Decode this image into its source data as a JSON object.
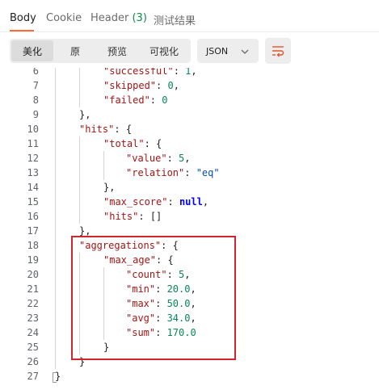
{
  "tabs": {
    "body": "Body",
    "cookie": "Cookie",
    "header": "Header",
    "header_count": "(3)",
    "test_results": "测试结果"
  },
  "toolbar": {
    "format_buttons": [
      "美化",
      "原",
      "预览",
      "可视化"
    ],
    "active_format": "美化",
    "language": "JSON",
    "wrap_icon": "text-wrap-icon"
  },
  "colors": {
    "accent": "#ff6c37",
    "key": "#a31515",
    "number": "#098658",
    "string": "#0451a5",
    "keyword": "#0000ff",
    "highlight": "#d0262d"
  },
  "code": {
    "line_numbers": [
      "6",
      "7",
      "8",
      "9",
      "10",
      "11",
      "12",
      "13",
      "14",
      "15",
      "16",
      "17",
      "18",
      "19",
      "20",
      "21",
      "22",
      "23",
      "24",
      "25",
      "26",
      "27"
    ],
    "lines": [
      {
        "k": "\"successful\"",
        "sep": ": ",
        "v": "1",
        "vt": "num",
        "tail": ","
      },
      {
        "k": "\"skipped\"",
        "sep": ": ",
        "v": "0",
        "vt": "num",
        "tail": ","
      },
      {
        "k": "\"failed\"",
        "sep": ": ",
        "v": "0",
        "vt": "num",
        "tail": ""
      },
      {
        "k": "",
        "sep": "",
        "v": "",
        "vt": "",
        "tail": "},"
      },
      {
        "k": "\"hits\"",
        "sep": ": ",
        "v": "",
        "vt": "",
        "tail": "{"
      },
      {
        "k": "\"total\"",
        "sep": ": ",
        "v": "",
        "vt": "",
        "tail": "{"
      },
      {
        "k": "\"value\"",
        "sep": ": ",
        "v": "5",
        "vt": "num",
        "tail": ","
      },
      {
        "k": "\"relation\"",
        "sep": ": ",
        "v": "\"eq\"",
        "vt": "str",
        "tail": ""
      },
      {
        "k": "",
        "sep": "",
        "v": "",
        "vt": "",
        "tail": "},"
      },
      {
        "k": "\"max_score\"",
        "sep": ": ",
        "v": "null",
        "vt": "kw",
        "tail": ","
      },
      {
        "k": "\"hits\"",
        "sep": ": ",
        "v": "",
        "vt": "",
        "tail": "[]"
      },
      {
        "k": "",
        "sep": "",
        "v": "",
        "vt": "",
        "tail": "},"
      },
      {
        "k": "\"aggregations\"",
        "sep": ": ",
        "v": "",
        "vt": "",
        "tail": "{"
      },
      {
        "k": "\"max_age\"",
        "sep": ": ",
        "v": "",
        "vt": "",
        "tail": "{"
      },
      {
        "k": "\"count\"",
        "sep": ": ",
        "v": "5",
        "vt": "num",
        "tail": ","
      },
      {
        "k": "\"min\"",
        "sep": ": ",
        "v": "20.0",
        "vt": "num",
        "tail": ","
      },
      {
        "k": "\"max\"",
        "sep": ": ",
        "v": "50.0",
        "vt": "num",
        "tail": ","
      },
      {
        "k": "\"avg\"",
        "sep": ": ",
        "v": "34.0",
        "vt": "num",
        "tail": ","
      },
      {
        "k": "\"sum\"",
        "sep": ": ",
        "v": "170.0",
        "vt": "num",
        "tail": ""
      },
      {
        "k": "",
        "sep": "",
        "v": "",
        "vt": "",
        "tail": "}"
      },
      {
        "k": "",
        "sep": "",
        "v": "",
        "vt": "",
        "tail": "}"
      },
      {
        "k": "",
        "sep": "",
        "v": "",
        "vt": "",
        "tail": "}"
      }
    ]
  }
}
